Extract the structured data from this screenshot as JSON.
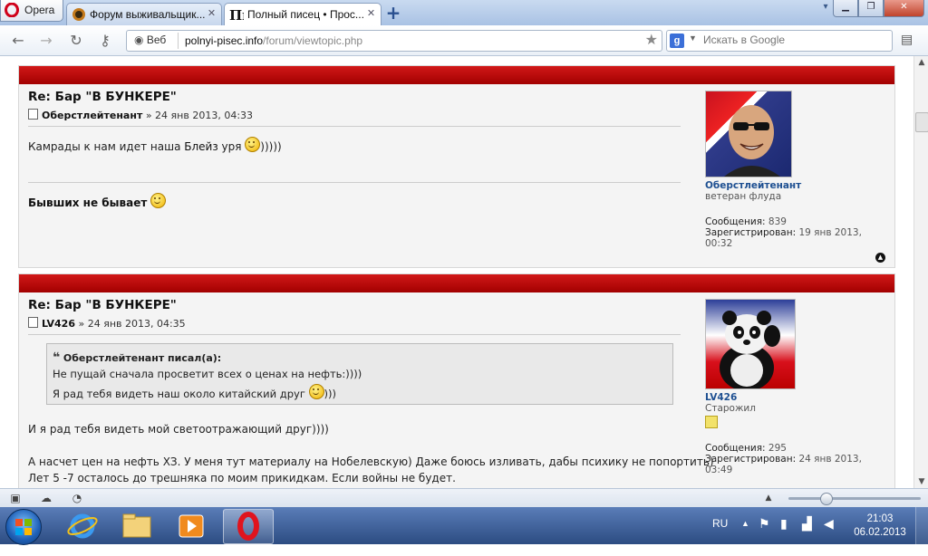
{
  "browser": {
    "menu_label": "Opera",
    "tabs": [
      {
        "title": "Форум выживальщик..."
      },
      {
        "title": "Полный писец • Прос..."
      }
    ],
    "address": {
      "web_label": "Веб",
      "url_host": "polnyi-pisec.info",
      "url_path": "/forum/viewtopic.php"
    },
    "search": {
      "placeholder": "Искать в Google"
    }
  },
  "posts": [
    {
      "title": "Re: Бар \"В БУНКЕРЕ\"",
      "author": "Оберстлейтенант",
      "date": "» 24 янв 2013, 04:33",
      "text_before": "Камрады к нам идет наша ",
      "text_bold": "Блейз",
      "text_after": " уря ",
      "text_tail": ")))))",
      "signature": "Бывших не бывает",
      "profile": {
        "username": "Оберстлейтенант",
        "rank": "ветеран флуда",
        "posts_label": "Сообщения:",
        "posts_value": "839",
        "registered_label": "Зарегистрирован:",
        "registered_value": "19 янв 2013, 00:32"
      }
    },
    {
      "title": "Re: Бар \"В БУНКЕРЕ\"",
      "author": "LV426",
      "date": "» 24 янв 2013, 04:35",
      "quote": {
        "cite": "Оберстлейтенант писал(а):",
        "line1": "Не пущай сначала просветит всех о ценах на нефть:))))",
        "line2": "Я рад тебя видеть наш около китайский друг ",
        "line2_tail": ")))"
      },
      "paragraph1": "И я рад тебя видеть мой светоотражающий друг))))",
      "paragraph2_line1": "А насчет цен на нефть ХЗ. У меня тут материалу на Нобелевскую) Даже боюсь изливать, дабы психику не попортить)",
      "paragraph2_line2": "Лет 5 -7 осталось до трешняка по моим прикидкам. Если войны не будет.",
      "profile": {
        "username": "LV426",
        "rank": "Старожил",
        "posts_label": "Сообщения:",
        "posts_value": "295",
        "registered_label": "Зарегистрирован:",
        "registered_value": "24 янв 2013, 03:49"
      }
    }
  ],
  "taskbar": {
    "language": "RU",
    "time": "21:03",
    "date": "06.02.2013"
  }
}
